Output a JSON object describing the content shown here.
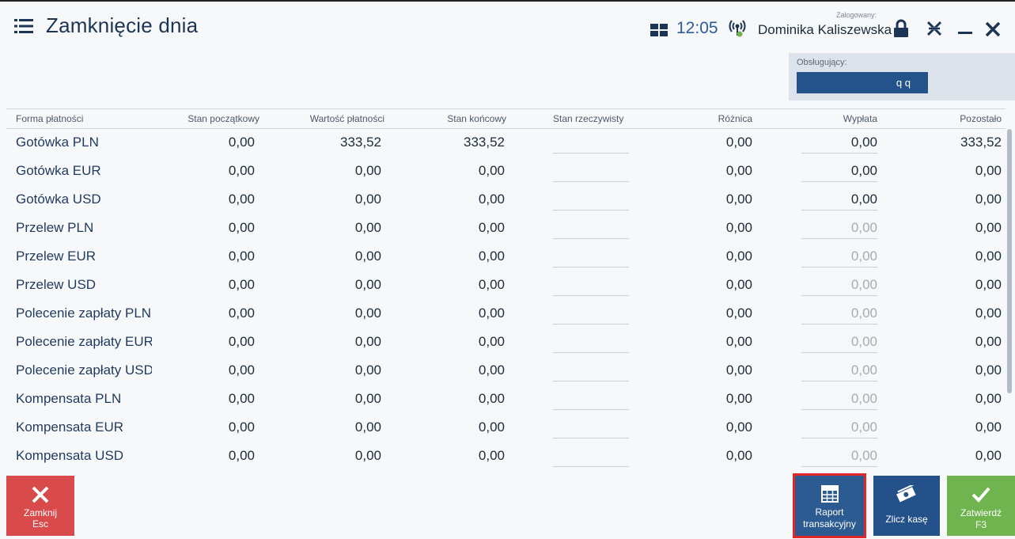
{
  "header": {
    "title": "Zamknięcie dnia",
    "time": "12:05",
    "logged_label": "Zalogowany:",
    "user": "Dominika Kaliszewska"
  },
  "operator": {
    "label": "Obsługujący:",
    "value": "q q"
  },
  "columns": [
    "Forma płatności",
    "Stan początkowy",
    "Wartość płatności",
    "Stan końcowy",
    "Stan rzeczywisty",
    "Różnica",
    "Wypłata",
    "Pozostało"
  ],
  "rows": [
    {
      "name": "Gotówka PLN",
      "start": "0,00",
      "payment": "333,52",
      "end": "333,52",
      "diff": "0,00",
      "payout": "0,00",
      "payout_active": true,
      "left": "333,52"
    },
    {
      "name": "Gotówka EUR",
      "start": "0,00",
      "payment": "0,00",
      "end": "0,00",
      "diff": "0,00",
      "payout": "0,00",
      "payout_active": true,
      "left": "0,00"
    },
    {
      "name": "Gotówka USD",
      "start": "0,00",
      "payment": "0,00",
      "end": "0,00",
      "diff": "0,00",
      "payout": "0,00",
      "payout_active": true,
      "left": "0,00"
    },
    {
      "name": "Przelew PLN",
      "start": "0,00",
      "payment": "0,00",
      "end": "0,00",
      "diff": "0,00",
      "payout": "0,00",
      "payout_active": false,
      "left": "0,00"
    },
    {
      "name": "Przelew EUR",
      "start": "0,00",
      "payment": "0,00",
      "end": "0,00",
      "diff": "0,00",
      "payout": "0,00",
      "payout_active": false,
      "left": "0,00"
    },
    {
      "name": "Przelew USD",
      "start": "0,00",
      "payment": "0,00",
      "end": "0,00",
      "diff": "0,00",
      "payout": "0,00",
      "payout_active": false,
      "left": "0,00"
    },
    {
      "name": "Polecenie zapłaty PLN",
      "start": "0,00",
      "payment": "0,00",
      "end": "0,00",
      "diff": "0,00",
      "payout": "0,00",
      "payout_active": false,
      "left": "0,00"
    },
    {
      "name": "Polecenie zapłaty EUR",
      "start": "0,00",
      "payment": "0,00",
      "end": "0,00",
      "diff": "0,00",
      "payout": "0,00",
      "payout_active": false,
      "left": "0,00"
    },
    {
      "name": "Polecenie zapłaty USD",
      "start": "0,00",
      "payment": "0,00",
      "end": "0,00",
      "diff": "0,00",
      "payout": "0,00",
      "payout_active": false,
      "left": "0,00"
    },
    {
      "name": "Kompensata PLN",
      "start": "0,00",
      "payment": "0,00",
      "end": "0,00",
      "diff": "0,00",
      "payout": "0,00",
      "payout_active": false,
      "left": "0,00"
    },
    {
      "name": "Kompensata EUR",
      "start": "0,00",
      "payment": "0,00",
      "end": "0,00",
      "diff": "0,00",
      "payout": "0,00",
      "payout_active": false,
      "left": "0,00"
    },
    {
      "name": "Kompensata USD",
      "start": "0,00",
      "payment": "0,00",
      "end": "0,00",
      "diff": "0,00",
      "payout": "0,00",
      "payout_active": false,
      "left": "0,00"
    }
  ],
  "buttons": {
    "close": {
      "label": "Zamknij",
      "key": "Esc"
    },
    "report": {
      "label1": "Raport",
      "label2": "transakcyjny"
    },
    "count": {
      "label": "Zlicz kasę"
    },
    "confirm": {
      "label": "Zatwierdź",
      "key": "F3"
    }
  },
  "colors": {
    "accent": "#2c5b92",
    "close": "#d94b4b",
    "confirm": "#6fb44e",
    "highlight": "#e2262a"
  },
  "icons": [
    "menu-icon",
    "grid-icon",
    "signal-icon",
    "lock-icon",
    "tools-icon",
    "minimize-icon",
    "close-icon",
    "calculator-icon",
    "money-icon",
    "check-icon"
  ]
}
